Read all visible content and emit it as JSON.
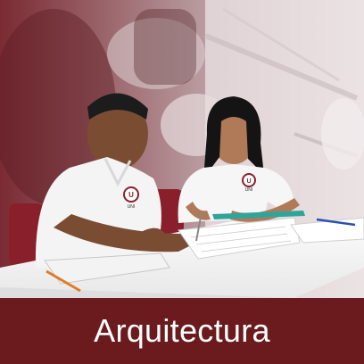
{
  "card": {
    "caption": "Arquitectura",
    "caption_bar_color": "#6b1a1e",
    "caption_text_color": "#ffffff",
    "photo_description_icon": "architecture-students-photo",
    "logo_text": "UNI"
  }
}
